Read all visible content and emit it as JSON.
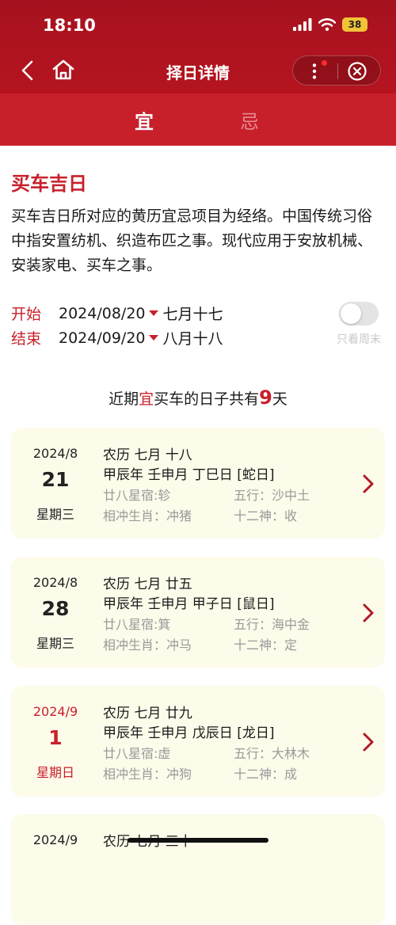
{
  "status": {
    "time": "18:10",
    "battery": "38"
  },
  "nav": {
    "title": "择日详情"
  },
  "tabs": [
    {
      "label": "宜"
    },
    {
      "label": "忌"
    }
  ],
  "topic": {
    "title": "买车吉日",
    "description": "买车吉日所对应的黄历宜忌项目为经络。中国传统习俗中指安置纺机、织造布匹之事。现代应用于安放机械、安装家电、买车之事。"
  },
  "range": {
    "start_label": "开始",
    "start_date": "2024/08/20",
    "start_lunar": "七月十七",
    "end_label": "结束",
    "end_date": "2024/09/20",
    "end_lunar": "八月十八",
    "weekend_only_label": "只看周末"
  },
  "summary": {
    "prefix": "近期",
    "yi": "宜",
    "middle": "买车的日子共有",
    "count": "9",
    "suffix": "天"
  },
  "accent_color": "#c8202b",
  "cards": [
    {
      "ym": "2024/8",
      "day": "21",
      "weekday": "星期三",
      "lunar": "农历 七月 十八",
      "ganzhi": "甲辰年 壬申月 丁巳日 [蛇日]",
      "star": "廿八星宿:轸",
      "wuxing": "五行：沙中土",
      "chong": "相冲生肖：冲猪",
      "shen": "十二神：收"
    },
    {
      "ym": "2024/8",
      "day": "28",
      "weekday": "星期三",
      "lunar": "农历 七月 廿五",
      "ganzhi": "甲辰年 壬申月 甲子日 [鼠日]",
      "star": "廿八星宿:箕",
      "wuxing": "五行：海中金",
      "chong": "相冲生肖：冲马",
      "shen": "十二神：定"
    },
    {
      "ym": "2024/9",
      "day": "1",
      "weekday": "星期日",
      "lunar": "农历 七月 廿九",
      "ganzhi": "甲辰年 壬申月 戊辰日 [龙日]",
      "star": "廿八星宿:虚",
      "wuxing": "五行：大林木",
      "chong": "相冲生肖：冲狗",
      "shen": "十二神：成"
    },
    {
      "ym": "2024/9",
      "lunar": "农历 七月 三十"
    }
  ]
}
